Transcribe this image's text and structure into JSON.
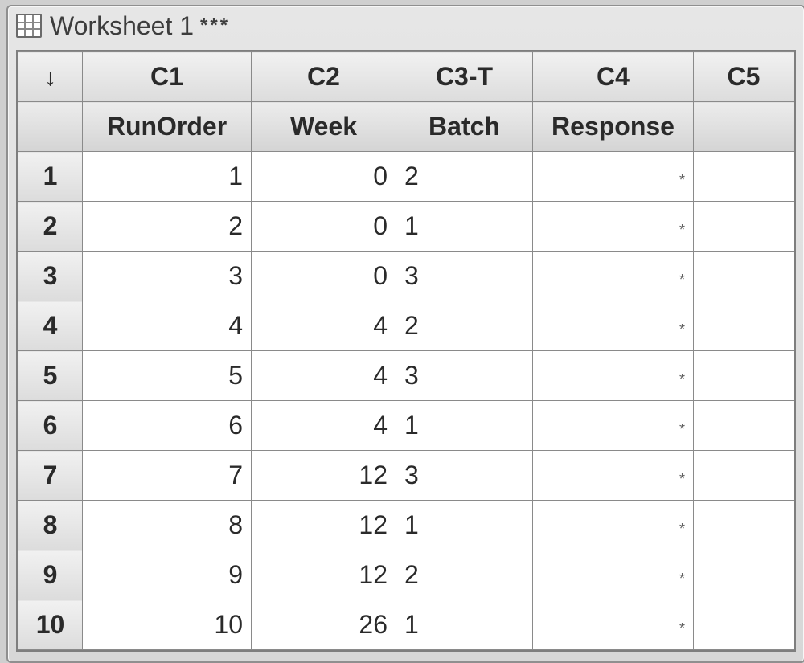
{
  "titlebar": {
    "title": "Worksheet 1",
    "dirty_marker": "***"
  },
  "header": {
    "corner_arrow": "↓",
    "columns": [
      "C1",
      "C2",
      "C3-T",
      "C4",
      "C5"
    ],
    "names": [
      "RunOrder",
      "Week",
      "Batch",
      "Response",
      ""
    ]
  },
  "rows": [
    {
      "n": "1",
      "c1": "1",
      "c2": "0",
      "c3": "2",
      "c4": "*",
      "c5": ""
    },
    {
      "n": "2",
      "c1": "2",
      "c2": "0",
      "c3": "1",
      "c4": "*",
      "c5": ""
    },
    {
      "n": "3",
      "c1": "3",
      "c2": "0",
      "c3": "3",
      "c4": "*",
      "c5": ""
    },
    {
      "n": "4",
      "c1": "4",
      "c2": "4",
      "c3": "2",
      "c4": "*",
      "c5": ""
    },
    {
      "n": "5",
      "c1": "5",
      "c2": "4",
      "c3": "3",
      "c4": "*",
      "c5": ""
    },
    {
      "n": "6",
      "c1": "6",
      "c2": "4",
      "c3": "1",
      "c4": "*",
      "c5": ""
    },
    {
      "n": "7",
      "c1": "7",
      "c2": "12",
      "c3": "3",
      "c4": "*",
      "c5": ""
    },
    {
      "n": "8",
      "c1": "8",
      "c2": "12",
      "c3": "1",
      "c4": "*",
      "c5": ""
    },
    {
      "n": "9",
      "c1": "9",
      "c2": "12",
      "c3": "2",
      "c4": "*",
      "c5": ""
    },
    {
      "n": "10",
      "c1": "10",
      "c2": "26",
      "c3": "1",
      "c4": "*",
      "c5": ""
    }
  ]
}
